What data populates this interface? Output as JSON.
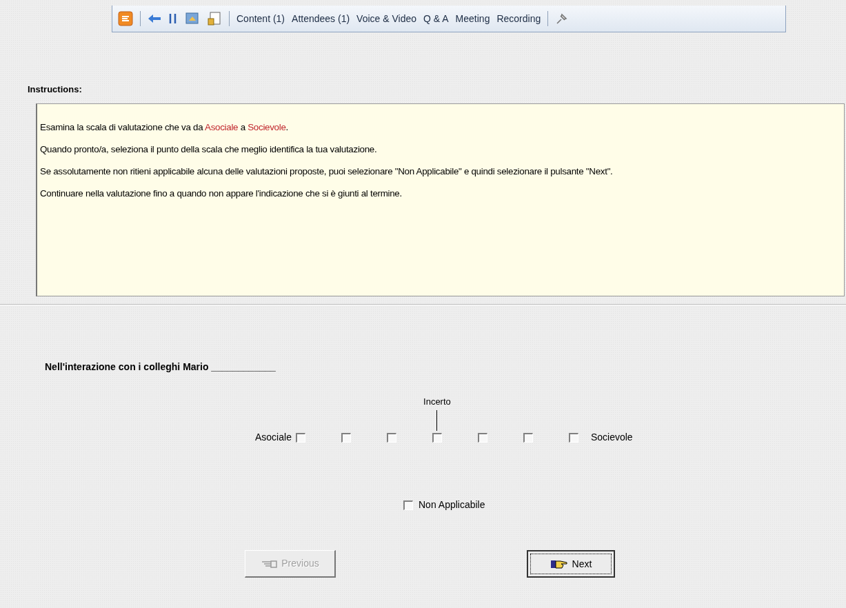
{
  "toolbar": {
    "items": [
      {
        "label": "Content (1)"
      },
      {
        "label": "Attendees (1)"
      },
      {
        "label": "Voice & Video"
      },
      {
        "label": "Q & A"
      },
      {
        "label": "Meeting"
      },
      {
        "label": "Recording"
      }
    ]
  },
  "instructions": {
    "heading": "Instructions:",
    "paragraphs": [
      [
        {
          "text": "Esamina la scala di valutazione che va da ",
          "highlight": false
        },
        {
          "text": "Asociale",
          "highlight": true
        },
        {
          "text": " a ",
          "highlight": false
        },
        {
          "text": "Socievole",
          "highlight": true
        },
        {
          "text": ".",
          "highlight": false
        }
      ],
      [
        {
          "text": "Quando pronto/a, seleziona il punto della scala che meglio identifica la tua valutazione.",
          "highlight": false
        }
      ],
      [
        {
          "text": "Se assolutamente non ritieni applicabile alcuna delle valutazioni proposte, puoi selezionare \"Non Applicabile\" e quindi selezionare il pulsante \"Next\".",
          "highlight": false
        }
      ],
      [
        {
          "text": "Continuare nella valutazione fino a quando non appare l'indicazione che si è giunti al termine.",
          "highlight": false
        }
      ]
    ]
  },
  "question": "Nell'interazione con i colleghi Mario ____________",
  "scale": {
    "left_label": "Asociale",
    "right_label": "Socievole",
    "midpoint_label": "Incerto",
    "options": [
      {
        "checked": false
      },
      {
        "checked": false
      },
      {
        "checked": false
      },
      {
        "checked": false
      },
      {
        "checked": false
      },
      {
        "checked": false
      },
      {
        "checked": false
      }
    ]
  },
  "not_applicable": {
    "label": "Non Applicabile",
    "checked": false
  },
  "buttons": [
    {
      "kind": "previous",
      "label": "Previous",
      "disabled": true,
      "focused": false
    },
    {
      "kind": "next",
      "label": "Next",
      "disabled": false,
      "focused": true
    }
  ]
}
